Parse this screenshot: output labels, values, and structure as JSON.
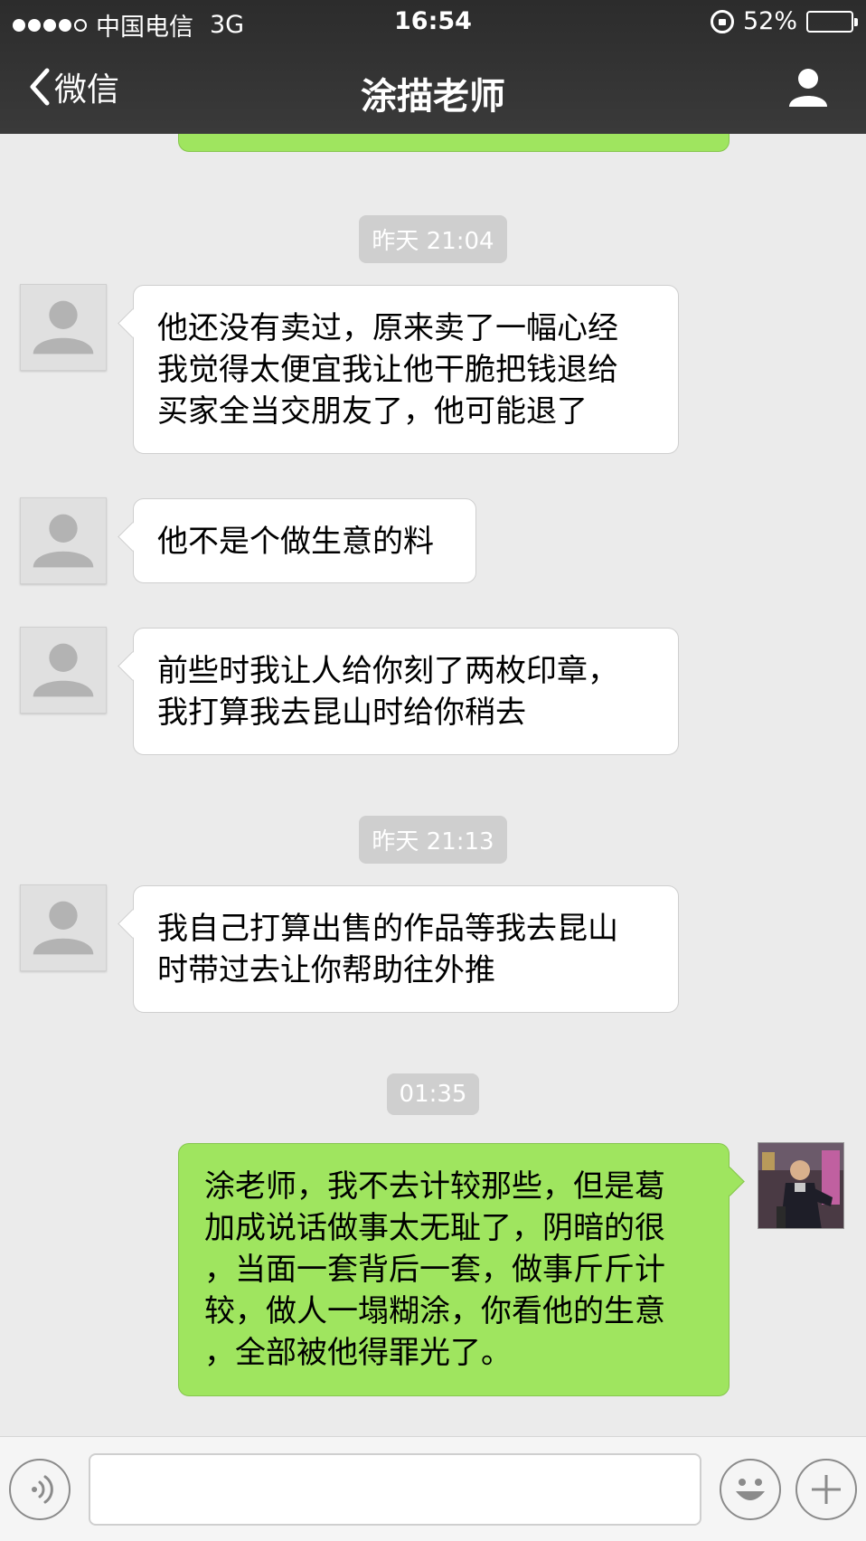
{
  "status_bar": {
    "carrier": "中国电信",
    "network": "3G",
    "time": "16:54",
    "battery": "52%",
    "battery_level": 0.52
  },
  "nav": {
    "back_label": "微信",
    "title": "涂描老师"
  },
  "messages": [
    {
      "type": "timestamp",
      "text": "昨天 21:04"
    },
    {
      "type": "received",
      "text": "他还没有卖过，原来卖了一幅心经\n我觉得太便宜我让他干脆把钱退给\n买家全当交朋友了，他可能退了"
    },
    {
      "type": "received",
      "text": "他不是个做生意的料"
    },
    {
      "type": "received",
      "text": "前些时我让人给你刻了两枚印章，\n我打算我去昆山时给你稍去"
    },
    {
      "type": "timestamp",
      "text": "昨天 21:13"
    },
    {
      "type": "received",
      "text": "我自己打算出售的作品等我去昆山\n时带过去让你帮助往外推"
    },
    {
      "type": "timestamp",
      "text": "01:35"
    },
    {
      "type": "sent",
      "text": "涂老师，我不去计较那些，但是葛\n加成说话做事太无耻了，阴暗的很\n，当面一套背后一套，做事斤斤计\n较，做人一塌糊涂，你看他的生意\n，全部被他得罪光了。"
    }
  ],
  "input": {
    "value": ""
  },
  "colors": {
    "sent_bubble": "#9fe55f",
    "received_bubble": "#ffffff",
    "background": "#ebebeb",
    "timestamp_bg": "#cfcfcf"
  }
}
